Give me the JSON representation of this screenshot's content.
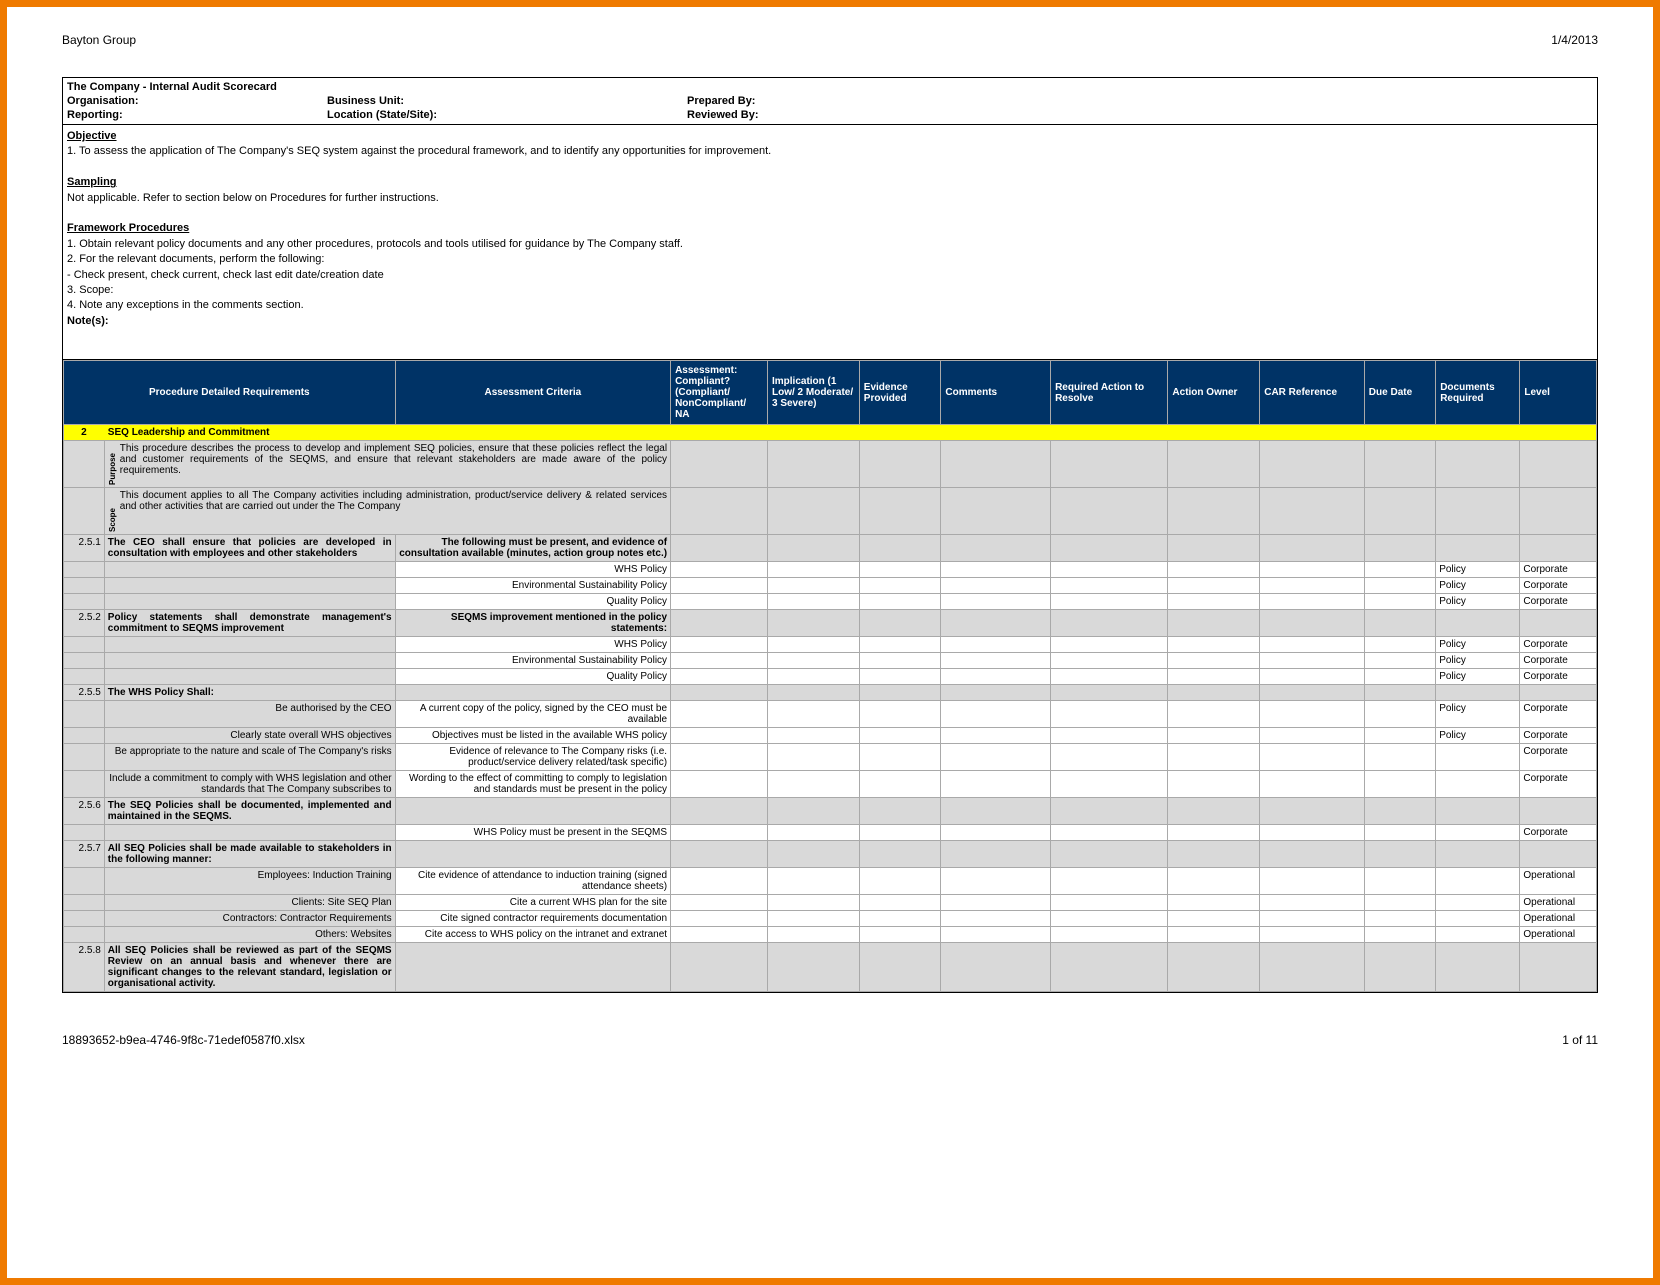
{
  "header": {
    "left": "Bayton Group",
    "right": "1/4/2013"
  },
  "footer": {
    "left": "18893652-b9ea-4746-9f8c-71edef0587f0.xlsx",
    "right": "1 of 11"
  },
  "top": {
    "title": "The Company - Internal Audit Scorecard",
    "organisation_label": "Organisation:",
    "reporting_label": "Reporting:",
    "business_unit_label": "Business Unit:",
    "location_label": "Location (State/Site):",
    "prepared_by_label": "Prepared By:",
    "reviewed_by_label": "Reviewed By:"
  },
  "notes": {
    "objective_h": "Objective",
    "objective": "1. To assess the application of The Company's SEQ system against the procedural framework, and to identify any opportunities for improvement.",
    "sampling_h": "Sampling",
    "sampling": "Not applicable. Refer to section below on Procedures for further instructions.",
    "framework_h": "Framework Procedures",
    "fp1": "1. Obtain relevant policy documents and any other procedures, protocols and tools utilised for guidance by The Company staff.",
    "fp2": "2. For the relevant documents, perform the following:",
    "fp2a": " - Check present, check current, check last edit date/creation date",
    "fp3": "3. Scope:",
    "fp4": "4. Note any exceptions in the comments section.",
    "notes_label": "Note(s):"
  },
  "columns": {
    "req": "Procedure Detailed Requirements",
    "criteria": "Assessment Criteria",
    "assessment": "Assessment: Compliant? (Compliant/ NonCompliant/ NA",
    "implication": "Implication (1 Low/ 2 Moderate/ 3 Severe)",
    "evidence": "Evidence Provided",
    "comments": "Comments",
    "action": "Required Action to Resolve",
    "owner": "Action Owner",
    "car": "CAR Reference",
    "due": "Due Date",
    "docs": "Documents Required",
    "level": "Level"
  },
  "section": {
    "num": "2",
    "title": "SEQ Leadership and Commitment"
  },
  "rows": [
    {
      "type": "grey2",
      "vlabel": "Purpose",
      "req": "This procedure describes the process to develop and implement SEQ policies, ensure that these policies reflect the legal and customer requirements of the SEQMS, and ensure that relevant stakeholders are made aware of the policy requirements."
    },
    {
      "type": "grey2",
      "vlabel": "Scope",
      "req": "This document applies to all The Company activities including administration, product/service delivery & related services and other activities that are carried out under the The Company"
    },
    {
      "type": "grey",
      "num": "2.5.1",
      "req": "The CEO shall ensure that policies are developed in consultation with employees and other stakeholders",
      "criteria": "The following must be present, and evidence of consultation available (minutes, action group notes etc.)",
      "bold": true
    },
    {
      "type": "plain",
      "criteria": "WHS Policy",
      "docs": "Policy",
      "level": "Corporate"
    },
    {
      "type": "plain",
      "criteria": "Environmental Sustainability Policy",
      "docs": "Policy",
      "level": "Corporate"
    },
    {
      "type": "plain",
      "criteria": "Quality Policy",
      "docs": "Policy",
      "level": "Corporate"
    },
    {
      "type": "grey",
      "num": "2.5.2",
      "req": "Policy statements shall demonstrate management's commitment to SEQMS improvement",
      "criteria": "SEQMS improvement mentioned in the policy statements:",
      "bold": true
    },
    {
      "type": "plain",
      "criteria": "WHS Policy",
      "docs": "Policy",
      "level": "Corporate"
    },
    {
      "type": "plain",
      "criteria": "Environmental Sustainability Policy",
      "docs": "Policy",
      "level": "Corporate"
    },
    {
      "type": "plain",
      "criteria": "Quality Policy",
      "docs": "Policy",
      "level": "Corporate"
    },
    {
      "type": "grey",
      "num": "2.5.5",
      "req": "The WHS Policy Shall:",
      "bold": true
    },
    {
      "type": "plain",
      "req": "Be authorised by the CEO",
      "criteria": "A current copy of the policy, signed by the CEO must be available",
      "docs": "Policy",
      "level": "Corporate"
    },
    {
      "type": "plain",
      "req": "Clearly state overall WHS objectives",
      "criteria": "Objectives must be listed in the available WHS policy",
      "docs": "Policy",
      "level": "Corporate"
    },
    {
      "type": "plain",
      "req": "Be appropriate to the nature and scale of The Company's risks",
      "criteria": "Evidence of relevance to The Company risks (i.e. product/service delivery related/task specific)",
      "level": "Corporate"
    },
    {
      "type": "plain",
      "req": "Include a commitment to comply with WHS legislation and other standards that The Company subscribes to",
      "criteria": "Wording to the effect of committing to comply to legislation and standards must be present in the policy",
      "level": "Corporate"
    },
    {
      "type": "grey",
      "num": "2.5.6",
      "req": "The SEQ Policies shall be documented, implemented and maintained in the SEQMS.",
      "bold": true
    },
    {
      "type": "plain",
      "criteria": "WHS Policy must be present in the SEQMS",
      "level": "Corporate"
    },
    {
      "type": "grey",
      "num": "2.5.7",
      "req": "All SEQ Policies shall be made available to stakeholders in the following manner:",
      "bold": true
    },
    {
      "type": "plain",
      "req": "Employees: Induction Training",
      "criteria": "Cite evidence of attendance to induction training (signed attendance sheets)",
      "level": "Operational"
    },
    {
      "type": "plain",
      "req": "Clients: Site SEQ Plan",
      "criteria": "Cite a current WHS plan for the site",
      "level": "Operational"
    },
    {
      "type": "plain",
      "req": "Contractors: Contractor Requirements",
      "criteria": "Cite signed contractor requirements documentation",
      "level": "Operational"
    },
    {
      "type": "plain",
      "req": "Others: Websites",
      "criteria": "Cite access to WHS policy on the intranet and extranet",
      "level": "Operational"
    },
    {
      "type": "grey",
      "num": "2.5.8",
      "req": "All SEQ Policies shall be reviewed as part of the SEQMS Review on an annual basis and whenever there are significant changes to the relevant standard, legislation or organisational activity.",
      "bold": true
    }
  ]
}
